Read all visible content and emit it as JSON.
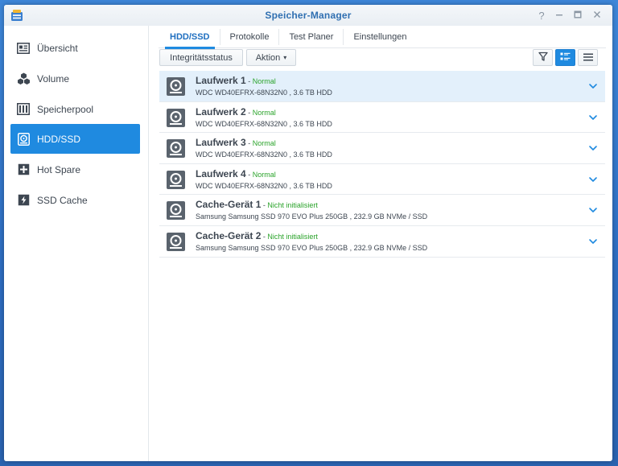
{
  "window": {
    "title": "Speicher-Manager",
    "controls": {
      "help": "?",
      "minimize": "—",
      "maximize": "□",
      "close": "✕"
    }
  },
  "sidebar": {
    "items": [
      {
        "label": "Übersicht",
        "icon": "overview-icon",
        "active": false
      },
      {
        "label": "Volume",
        "icon": "volume-icon",
        "active": false
      },
      {
        "label": "Speicherpool",
        "icon": "storage-pool-icon",
        "active": false
      },
      {
        "label": "HDD/SSD",
        "icon": "hdd-icon",
        "active": true
      },
      {
        "label": "Hot Spare",
        "icon": "hot-spare-icon",
        "active": false
      },
      {
        "label": "SSD Cache",
        "icon": "ssd-cache-icon",
        "active": false
      }
    ]
  },
  "tabs": [
    {
      "label": "HDD/SSD",
      "active": true
    },
    {
      "label": "Protokolle",
      "active": false
    },
    {
      "label": "Test Planer",
      "active": false
    },
    {
      "label": "Einstellungen",
      "active": false
    }
  ],
  "toolbar": {
    "integrity_label": "Integritätsstatus",
    "action_label": "Aktion",
    "action_caret": "▾"
  },
  "colors": {
    "accent": "#1f8ae0",
    "title": "#2f6fb1",
    "status_ok": "#2aa32a",
    "selected_row": "#e3f0fb"
  },
  "drives": [
    {
      "name": "Laufwerk 1",
      "sep": " - ",
      "status": "Normal",
      "detail": "WDC WD40EFRX-68N32N0 , 3.6 TB HDD",
      "selected": true
    },
    {
      "name": "Laufwerk 2",
      "sep": " - ",
      "status": "Normal",
      "detail": "WDC WD40EFRX-68N32N0 , 3.6 TB HDD",
      "selected": false
    },
    {
      "name": "Laufwerk 3",
      "sep": " - ",
      "status": "Normal",
      "detail": "WDC WD40EFRX-68N32N0 , 3.6 TB HDD",
      "selected": false
    },
    {
      "name": "Laufwerk 4",
      "sep": " - ",
      "status": "Normal",
      "detail": "WDC WD40EFRX-68N32N0 , 3.6 TB HDD",
      "selected": false
    },
    {
      "name": "Cache-Gerät 1",
      "sep": " - ",
      "status": "Nicht initialisiert",
      "detail": "Samsung Samsung SSD 970 EVO Plus 250GB , 232.9 GB NVMe / SSD",
      "selected": false
    },
    {
      "name": "Cache-Gerät 2",
      "sep": " - ",
      "status": "Nicht initialisiert",
      "detail": "Samsung Samsung SSD 970 EVO Plus 250GB , 232.9 GB NVMe / SSD",
      "selected": false
    }
  ]
}
